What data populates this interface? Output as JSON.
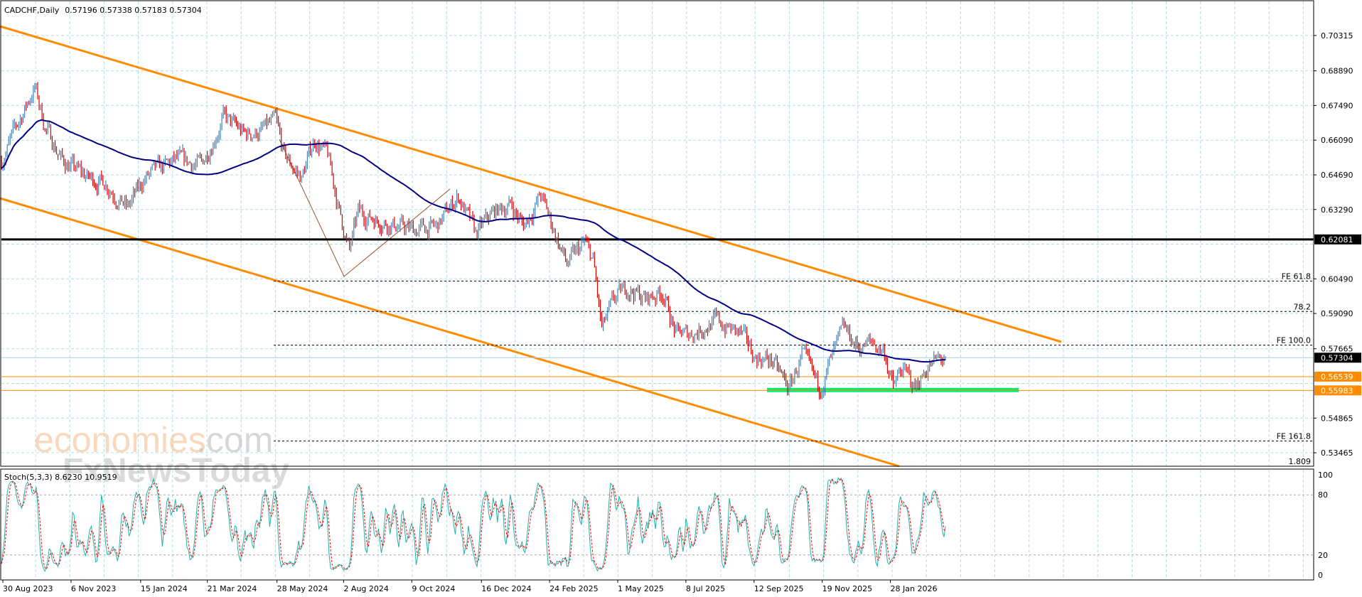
{
  "header": {
    "symbol": "CADCHF,Daily",
    "ohlc": "0.57196 0.57338 0.57183 0.57304"
  },
  "watermark": {
    "brand1": "economies",
    "brand1_suffix": ".com",
    "brand2": "FxNewsToday"
  },
  "chart_data": {
    "type": "ohlc-bar",
    "title": "CADCHF,Daily",
    "ylim": [
      0.53,
      0.71
    ],
    "price_ticks": [
      "0.70315",
      "0.68890",
      "0.67490",
      "0.66090",
      "0.64690",
      "0.63290",
      "0.60490",
      "0.59090",
      "0.57665",
      "0.54865",
      "0.53465"
    ],
    "date_ticks": [
      {
        "bar": 1,
        "label": "30 Aug 2023"
      },
      {
        "bar": 48,
        "label": "6 Nov 2023"
      },
      {
        "bar": 96,
        "label": "15 Jan 2024"
      },
      {
        "bar": 142,
        "label": "21 Mar 2024"
      },
      {
        "bar": 190,
        "label": "28 May 2024"
      },
      {
        "bar": 236,
        "label": "2 Aug 2024"
      },
      {
        "bar": 283,
        "label": "9 Oct 2024"
      },
      {
        "bar": 331,
        "label": "16 Dec 2024"
      },
      {
        "bar": 378,
        "label": "24 Feb 2025"
      },
      {
        "bar": 425,
        "label": "1 May 2025"
      },
      {
        "bar": 472,
        "label": "8 Jul 2025"
      },
      {
        "bar": 519,
        "label": "12 Sep 2025"
      },
      {
        "bar": 566,
        "label": "19 Nov 2025"
      },
      {
        "bar": 613,
        "label": "28 Jan 2026"
      }
    ],
    "close_path": [
      [
        0,
        0.6526
      ],
      [
        12,
        0.6684
      ],
      [
        23,
        0.6824
      ],
      [
        30,
        0.6666
      ],
      [
        42,
        0.6526
      ],
      [
        60,
        0.6456
      ],
      [
        72,
        0.6439
      ],
      [
        87,
        0.6333
      ],
      [
        99,
        0.6456
      ],
      [
        120,
        0.6526
      ],
      [
        138,
        0.6509
      ],
      [
        153,
        0.6701
      ],
      [
        168,
        0.6631
      ],
      [
        180,
        0.6649
      ],
      [
        189,
        0.6684
      ],
      [
        195,
        0.6544
      ],
      [
        207,
        0.6456
      ],
      [
        216,
        0.6614
      ],
      [
        225,
        0.6544
      ],
      [
        234,
        0.6298
      ],
      [
        240,
        0.6158
      ],
      [
        246,
        0.6316
      ],
      [
        264,
        0.6281
      ],
      [
        282,
        0.6246
      ],
      [
        300,
        0.6256
      ],
      [
        315,
        0.6386
      ],
      [
        327,
        0.6228
      ],
      [
        339,
        0.6316
      ],
      [
        351,
        0.6351
      ],
      [
        360,
        0.6263
      ],
      [
        372,
        0.6386
      ],
      [
        381,
        0.6246
      ],
      [
        390,
        0.6105
      ],
      [
        402,
        0.6193
      ],
      [
        408,
        0.6123
      ],
      [
        414,
        0.5842
      ],
      [
        423,
        0.5965
      ],
      [
        432,
        0.6017
      ],
      [
        444,
        0.5965
      ],
      [
        456,
        0.6
      ],
      [
        465,
        0.5825
      ],
      [
        474,
        0.5825
      ],
      [
        492,
        0.5878
      ],
      [
        510,
        0.5825
      ],
      [
        519,
        0.5737
      ],
      [
        531,
        0.572
      ],
      [
        543,
        0.5605
      ],
      [
        552,
        0.5737
      ],
      [
        564,
        0.5605
      ],
      [
        581,
        0.5842
      ],
      [
        591,
        0.5772
      ],
      [
        600,
        0.579
      ],
      [
        609,
        0.5755
      ],
      [
        615,
        0.5605
      ],
      [
        621,
        0.5685
      ],
      [
        630,
        0.561
      ],
      [
        639,
        0.57
      ],
      [
        651,
        0.57304
      ]
    ],
    "moving_average": {
      "period": 100,
      "color": "#000080"
    },
    "levels": [
      {
        "price": 0.62081,
        "label": "0.62081",
        "color": "#000000"
      },
      {
        "price": 0.57304,
        "label": "0.57304",
        "color": "#000000"
      },
      {
        "price": 0.56539,
        "label": "0.56539",
        "color": "#ff8c00"
      },
      {
        "price": 0.55983,
        "label": "0.55983",
        "color": "#ff8c00"
      }
    ],
    "fibo_expansion": [
      {
        "price": 0.604,
        "label": "FE 61.8"
      },
      {
        "price": 0.5917,
        "label": "78.2"
      },
      {
        "price": 0.5781,
        "label": "FE 100.0"
      },
      {
        "price": 0.5394,
        "label": "FE 161.8"
      },
      {
        "price": 0.5292,
        "label": "1.809"
      }
    ],
    "support_zone": {
      "price": 0.56,
      "color": "#00ee77"
    },
    "colors": {
      "up": "#4682b4",
      "down": "#e00000",
      "channel": "#ff8c00",
      "grid": "#b0dce4"
    },
    "stochastic": {
      "label": "Stoch(5,3,3) 8.6230 10.9519",
      "params": [
        5,
        3,
        3
      ],
      "levels": [
        80,
        20
      ],
      "ticks": [
        "100",
        "80",
        "20",
        "0"
      ],
      "main_color": "#20b2aa",
      "signal_color": "#ff0000"
    }
  }
}
